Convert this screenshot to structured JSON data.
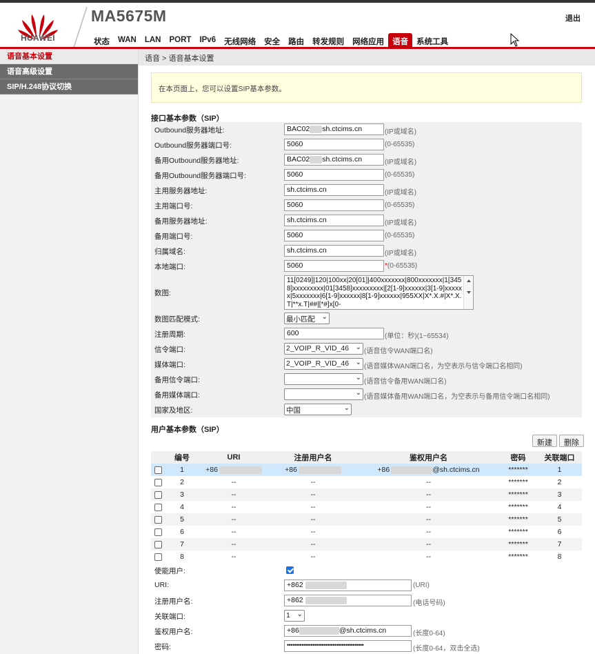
{
  "header": {
    "brand": "HUAWEI",
    "model": "MA5675M",
    "logout": "退出",
    "brand_color": "#c7000b",
    "nav": [
      "状态",
      "WAN",
      "LAN",
      "PORT",
      "IPv6",
      "无线网络",
      "安全",
      "路由",
      "转发规则",
      "网络应用",
      "语音",
      "系统工具"
    ],
    "active_nav": "语音"
  },
  "sidebar": {
    "items": [
      "语音基本设置",
      "语音高级设置",
      "SIP/H.248协议切换"
    ]
  },
  "breadcrumb": "语音 > 语音基本设置",
  "notice": "在本页面上，您可以设置SIP基本参数。",
  "sip_section": {
    "title": "接口基本参数（SIP）",
    "rows": [
      {
        "label": "Outbound服务器地址:",
        "pre": "BAC02",
        "value": "sh.ctcims.cn",
        "hint": "(IP或域名)"
      },
      {
        "label": "Outbound服务器端口号:",
        "pre": "",
        "value": "5060",
        "hint": "(0-65535)"
      },
      {
        "label": "备用Outbound服务器地址:",
        "pre": "BAC02",
        "value": "sh.ctcims.cn",
        "hint": "(IP或域名)"
      },
      {
        "label": "备用Outbound服务器端口号:",
        "pre": "",
        "value": "5060",
        "hint": "(0-65535)"
      },
      {
        "label": "主用服务器地址:",
        "pre": "",
        "value": "sh.ctcims.cn",
        "hint": "(IP或域名)"
      },
      {
        "label": "主用端口号:",
        "pre": "",
        "value": "5060",
        "hint": "(0-65535)"
      },
      {
        "label": "备用服务器地址:",
        "pre": "",
        "value": "sh.ctcims.cn",
        "hint": "(IP或域名)"
      },
      {
        "label": "备用端口号:",
        "pre": "",
        "value": "5060",
        "hint": "(0-65535)"
      },
      {
        "label": "归属域名:",
        "pre": "",
        "value": "sh.ctcims.cn",
        "hint": "(IP或域名)"
      },
      {
        "label": "本地端口:",
        "pre": "",
        "value": "5060",
        "hint": "*(0-65535)"
      }
    ],
    "digitmap_label": "数图:",
    "digitmap_value": "11[0249]|120|100xx|20[01]|400xxxxxxx|800xxxxxxx|1[3458]xxxxxxxxx|01[3458]xxxxxxxxx|[2[1-9]xxxxxx|3[1-9]xxxxxx|5xxxxxxx|6[1-9]xxxxxx|8[1-9]xxxxxx|955XX|X*.X.#|X*.X.T|**x.T|##|[*#]x[0-",
    "match_label": "数图匹配模式:",
    "match_value": "最小匹配",
    "reg_label": "注册周期:",
    "reg_value": "600",
    "reg_hint": "(单位：秒)(1~65534)",
    "sig_label": "信令端口:",
    "sig_value": "2_VOIP_R_VID_46",
    "sig_hint": "(语音信令WAN端口名)",
    "media_label": "媒体端口:",
    "media_value": "2_VOIP_R_VID_46",
    "media_hint": "(语音媒体WAN端口名，为空表示与信令端口名相同)",
    "bsig_label": "备用信令端口:",
    "bsig_value": "",
    "bsig_hint": "(语音信令备用WAN端口名)",
    "bmedia_label": "备用媒体端口:",
    "bmedia_value": "",
    "bmedia_hint": "(语音媒体备用WAN端口名，为空表示与备用信令端口名相同)",
    "country_label": "国家及地区:",
    "country_value": "中国"
  },
  "user_section": {
    "title": "用户基本参数（SIP）",
    "new_button": "新建",
    "delete_button": "删除",
    "columns": [
      "编号",
      "URI",
      "注册用户名",
      "鉴权用户名",
      "密码",
      "关联端口"
    ],
    "rows": [
      {
        "id": "1",
        "uri": "+86",
        "reg": "+86",
        "auth": "+86",
        "auth_suffix": "@sh.ctcims.cn",
        "pwd": "*******",
        "port": "1"
      },
      {
        "id": "2",
        "uri": "--",
        "reg": "--",
        "auth": "--",
        "auth_suffix": "",
        "pwd": "*******",
        "port": "2"
      },
      {
        "id": "3",
        "uri": "--",
        "reg": "--",
        "auth": "--",
        "auth_suffix": "",
        "pwd": "*******",
        "port": "3"
      },
      {
        "id": "4",
        "uri": "--",
        "reg": "--",
        "auth": "--",
        "auth_suffix": "",
        "pwd": "*******",
        "port": "4"
      },
      {
        "id": "5",
        "uri": "--",
        "reg": "--",
        "auth": "--",
        "auth_suffix": "",
        "pwd": "*******",
        "port": "5"
      },
      {
        "id": "6",
        "uri": "--",
        "reg": "--",
        "auth": "--",
        "auth_suffix": "",
        "pwd": "*******",
        "port": "6"
      },
      {
        "id": "7",
        "uri": "--",
        "reg": "--",
        "auth": "--",
        "auth_suffix": "",
        "pwd": "*******",
        "port": "7"
      },
      {
        "id": "8",
        "uri": "--",
        "reg": "--",
        "auth": "--",
        "auth_suffix": "",
        "pwd": "*******",
        "port": "8"
      }
    ],
    "enable_label": "使能用户:",
    "uri_label": "URI:",
    "uri_value": "+862",
    "uri_hint": "(URI)",
    "reguser_label": "注册用户名:",
    "reguser_value": "+862",
    "reguser_hint": "(电话号码)",
    "port_label": "关联端口:",
    "port_value": "1",
    "authuser_label": "鉴权用户名:",
    "authuser_value": "+86",
    "authuser_suffix": "@sh.ctcims.cn",
    "authuser_hint": "(长度0-64)",
    "pwd_label": "密码:",
    "pwd_value": "••••••••••••••••••••••••••••••••••••••••••",
    "pwd_hint": "(长度0-64，双击全选)"
  }
}
